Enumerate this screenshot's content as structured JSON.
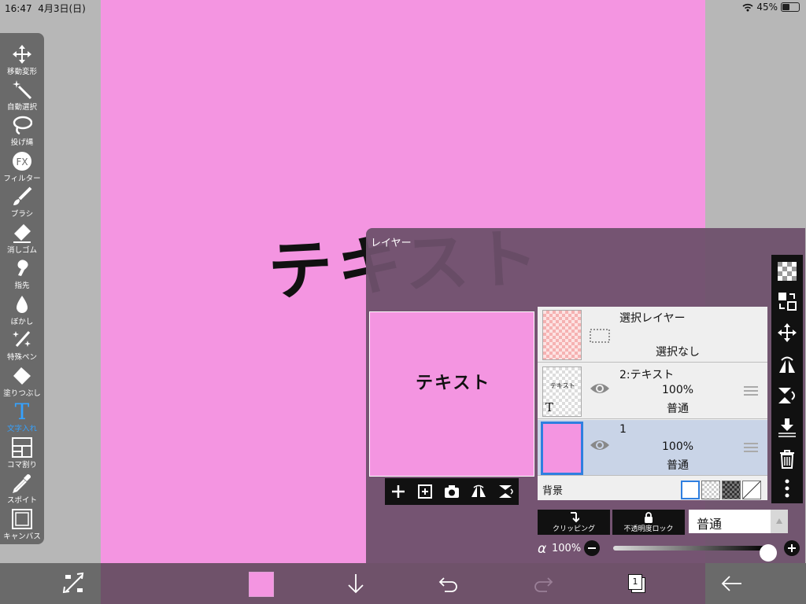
{
  "status": {
    "time": "16:47",
    "date": "4月3日(日)",
    "battery": "45%"
  },
  "canvas": {
    "text": "テキスト",
    "bg_color": "#f495e1"
  },
  "tools": [
    {
      "label": "移動変形",
      "icon": "move-icon"
    },
    {
      "label": "自動選択",
      "icon": "magic-wand-icon"
    },
    {
      "label": "投げ縄",
      "icon": "lasso-icon"
    },
    {
      "label": "フィルター",
      "icon": "fx-icon"
    },
    {
      "label": "ブラシ",
      "icon": "brush-icon"
    },
    {
      "label": "消しゴム",
      "icon": "eraser-icon"
    },
    {
      "label": "指先",
      "icon": "smudge-icon"
    },
    {
      "label": "ぼかし",
      "icon": "blur-icon"
    },
    {
      "label": "特殊ペン",
      "icon": "special-pen-icon"
    },
    {
      "label": "塗りつぶし",
      "icon": "fill-icon"
    },
    {
      "label": "文字入れ",
      "icon": "text-icon",
      "active": true
    },
    {
      "label": "コマ割り",
      "icon": "frame-divider-icon"
    },
    {
      "label": "スポイト",
      "icon": "eyedropper-icon"
    },
    {
      "label": "キャンバス",
      "icon": "canvas-icon"
    }
  ],
  "layer_panel": {
    "title": "レイヤー",
    "preview_text": "テキスト",
    "layers": [
      {
        "name": "選択レイヤー",
        "status": "選択なし"
      },
      {
        "name": "2:テキスト",
        "opacity": "100%",
        "mode": "普通",
        "thumb_text": "テキスト",
        "thumb_badge": "T"
      },
      {
        "name": "1",
        "opacity": "100%",
        "mode": "普通"
      }
    ],
    "background_label": "背景",
    "clipping_label": "クリッピング",
    "lock_label": "不透明度ロック",
    "blend_mode": "普通",
    "alpha_symbol": "α",
    "alpha_value": "100%",
    "alpha_level": 1.0
  },
  "bottom": {
    "page_count": "1",
    "color": "#f495e1"
  }
}
